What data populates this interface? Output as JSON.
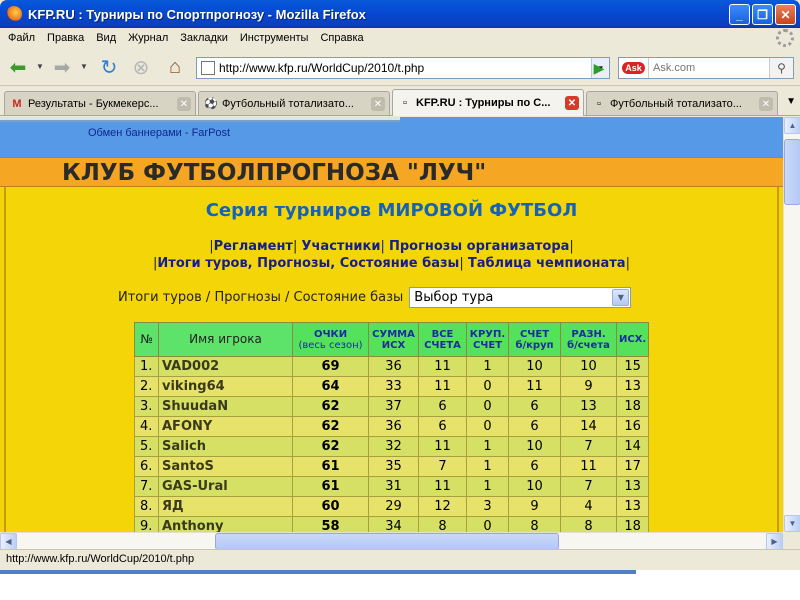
{
  "window": {
    "title": "KFP.RU : Турниры по Спортпрогнозу - Mozilla Firefox",
    "minimize_label": "_",
    "maximize_label": "❐",
    "close_label": "✕"
  },
  "menu": {
    "items": [
      "Файл",
      "Правка",
      "Вид",
      "Журнал",
      "Закладки",
      "Инструменты",
      "Справка"
    ]
  },
  "toolbar": {
    "url": "http://www.kfp.ru/WorldCup/2010/t.php",
    "search_placeholder": "Ask.com",
    "search_engine": "Ask"
  },
  "tabs": [
    {
      "label": "Результаты - Букмекерс...",
      "icon": "gmail-icon",
      "active": false
    },
    {
      "label": "Футбольный тотализато...",
      "icon": "soccer-ball-icon",
      "active": false
    },
    {
      "label": "KFP.RU : Турниры по С...",
      "icon": "page-icon",
      "active": true
    },
    {
      "label": "Футбольный тотализато...",
      "icon": "page-icon",
      "active": false
    }
  ],
  "page": {
    "banner_link": "Обмен баннерами - FarPost",
    "club_title": "КЛУБ ФУТБОЛПРОГНОЗА \"ЛУЧ\"",
    "series_title": "Серия турниров МИРОВОЙ ФУТБОЛ",
    "links_row1": [
      "Регламент",
      "Участники",
      "Прогнозы организатора"
    ],
    "links_row2": [
      "Итоги туров, Прогнозы, Состояние базы",
      "Таблица чемпионата"
    ],
    "select_label": "Итоги туров / Прогнозы / Состояние базы",
    "select_value": "Выбор тура"
  },
  "table": {
    "headers": {
      "num": "№",
      "name": "Имя игрока",
      "points": "ОЧКИ",
      "points_sub": "(весь сезон)",
      "sum_1": "СУММА",
      "sum_2": "ИСХ",
      "all_1": "ВСЕ",
      "all_2": "СЧЕТА",
      "big_1": "КРУП.",
      "big_2": "СЧЕТ",
      "score_1": "СЧЕТ",
      "score_2": "б/круп",
      "diff_1": "РАЗН.",
      "diff_2": "б/счета",
      "outcome": "ИСХ."
    },
    "rows": [
      {
        "n": "1.",
        "name": "VAD002",
        "pts": "69",
        "sum": "36",
        "all": "11",
        "big": "1",
        "score": "10",
        "diff": "10",
        "out": "15"
      },
      {
        "n": "2.",
        "name": "viking64",
        "pts": "64",
        "sum": "33",
        "all": "11",
        "big": "0",
        "score": "11",
        "diff": "9",
        "out": "13"
      },
      {
        "n": "3.",
        "name": "ShuudaN",
        "pts": "62",
        "sum": "37",
        "all": "6",
        "big": "0",
        "score": "6",
        "diff": "13",
        "out": "18"
      },
      {
        "n": "4.",
        "name": "AFONY",
        "pts": "62",
        "sum": "36",
        "all": "6",
        "big": "0",
        "score": "6",
        "diff": "14",
        "out": "16"
      },
      {
        "n": "5.",
        "name": "Salich",
        "pts": "62",
        "sum": "32",
        "all": "11",
        "big": "1",
        "score": "10",
        "diff": "7",
        "out": "14"
      },
      {
        "n": "6.",
        "name": "SantoS",
        "pts": "61",
        "sum": "35",
        "all": "7",
        "big": "1",
        "score": "6",
        "diff": "11",
        "out": "17"
      },
      {
        "n": "7.",
        "name": "GAS-Ural",
        "pts": "61",
        "sum": "31",
        "all": "11",
        "big": "1",
        "score": "10",
        "diff": "7",
        "out": "13"
      },
      {
        "n": "8.",
        "name": "ЯД",
        "pts": "60",
        "sum": "29",
        "all": "12",
        "big": "3",
        "score": "9",
        "diff": "4",
        "out": "13"
      },
      {
        "n": "9.",
        "name": "Anthony",
        "pts": "58",
        "sum": "34",
        "all": "8",
        "big": "0",
        "score": "8",
        "diff": "8",
        "out": "18"
      }
    ]
  },
  "status": {
    "text": "http://www.kfp.ru/WorldCup/2010/t.php"
  }
}
